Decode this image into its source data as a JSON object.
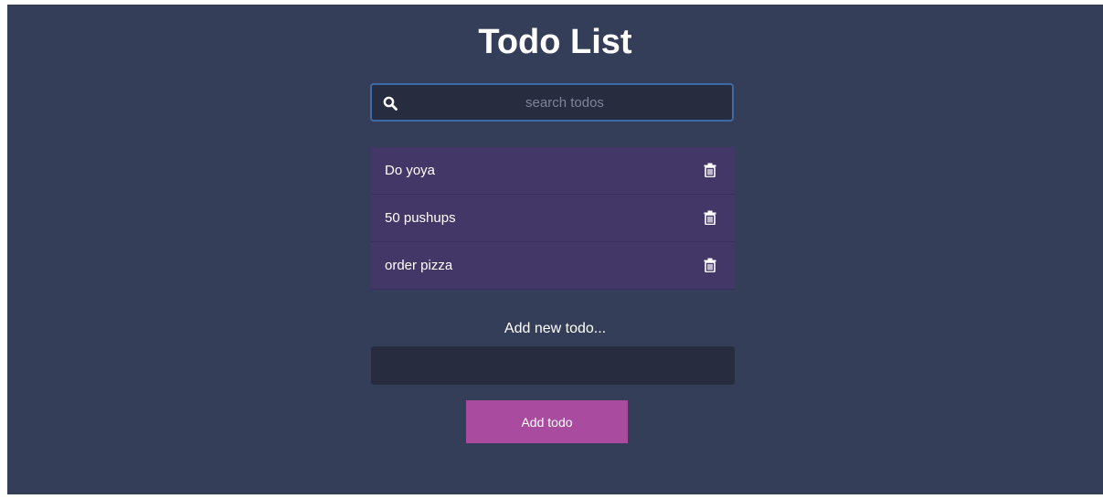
{
  "app": {
    "title": "Todo List"
  },
  "search": {
    "placeholder": "search todos",
    "value": "",
    "icon": "search-icon"
  },
  "todos": [
    {
      "label": "Do yoya",
      "icon": "trash-icon"
    },
    {
      "label": "50 pushups",
      "icon": "trash-icon"
    },
    {
      "label": "order pizza",
      "icon": "trash-icon"
    }
  ],
  "add": {
    "label": "Add new todo...",
    "input_value": "",
    "button_label": "Add todo"
  },
  "colors": {
    "background": "#353e58",
    "input_background": "#272c3f",
    "search_border": "#3f6aa8",
    "todo_item": "#433768",
    "button": "#a94b9f",
    "text": "#ffffff"
  }
}
